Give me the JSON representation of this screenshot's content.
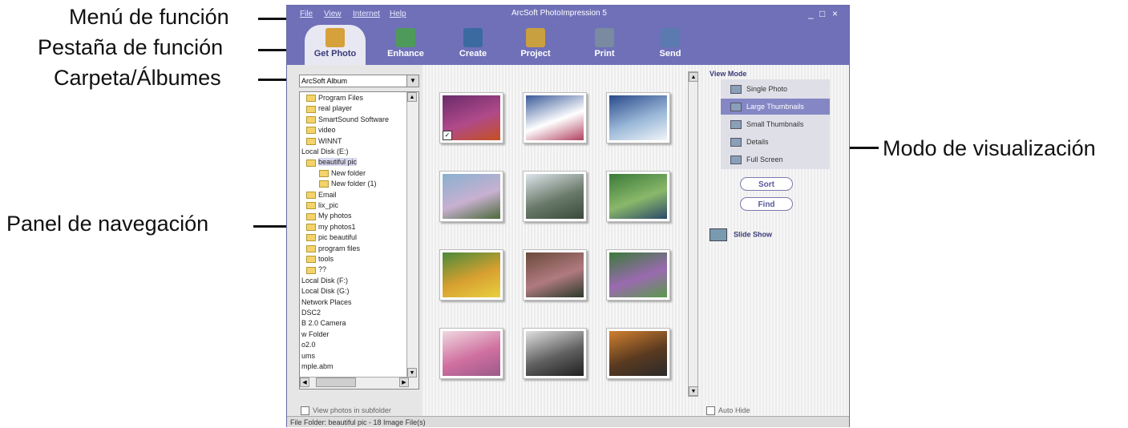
{
  "annotations": {
    "menu": "Menú de función",
    "tabs": "Pestaña de función",
    "albums": "Carpeta/Álbumes",
    "nav_panel": "Panel de navegación",
    "view_mode": "Modo de visualización"
  },
  "window": {
    "title": "ArcSoft PhotoImpression 5",
    "menu": [
      "File",
      "View",
      "Internet",
      "Help"
    ],
    "controls": [
      "_",
      "□",
      "×"
    ]
  },
  "tabs": [
    {
      "label": "Get Photo",
      "icon": "get-photo-icon",
      "color": "#d6a03a"
    },
    {
      "label": "Enhance",
      "icon": "enhance-icon",
      "color": "#4e9a5a"
    },
    {
      "label": "Create",
      "icon": "create-icon",
      "color": "#3a6aa0"
    },
    {
      "label": "Project",
      "icon": "project-icon",
      "color": "#c9a040"
    },
    {
      "label": "Print",
      "icon": "print-icon",
      "color": "#7a8aa0"
    },
    {
      "label": "Send",
      "icon": "send-icon",
      "color": "#5a7ab0"
    }
  ],
  "nav": {
    "album_select": "ArcSoft Album",
    "tree": [
      "Program Files",
      "real player",
      "SmartSound Software",
      "video",
      "WINNT",
      "Local Disk (E:)",
      "beautiful pic",
      "New folder",
      "New folder (1)",
      "Email",
      "lix_pic",
      "My photos",
      "my photos1",
      "pic beautiful",
      "program files",
      "tools",
      "??",
      "Local Disk (F:)",
      "Local Disk (G:)",
      "Network Places",
      "DSC2",
      "B 2.0 Camera",
      "w Folder",
      "o2.0",
      "ums",
      "mple.abm"
    ],
    "subfolder_label": "View photos in subfolder"
  },
  "thumbnails": [
    {
      "colors": [
        "#6a2a6a",
        "#b04a8a",
        "#c45020"
      ]
    },
    {
      "colors": [
        "#3a5a9a",
        "#ffffff",
        "#b04060"
      ]
    },
    {
      "colors": [
        "#2a4a8a",
        "#9ab8d8",
        "#f0f4f8"
      ]
    },
    {
      "colors": [
        "#8ab0d0",
        "#c8b0d0",
        "#4a6a3a"
      ]
    },
    {
      "colors": [
        "#dde4ea",
        "#6a7a6a",
        "#3a4a3a"
      ]
    },
    {
      "colors": [
        "#3a7a3a",
        "#8ab86a",
        "#2a4a6a"
      ]
    },
    {
      "colors": [
        "#4a8a3a",
        "#d8a030",
        "#e8d040"
      ]
    },
    {
      "colors": [
        "#6a4a3a",
        "#b07a80",
        "#2a3a2a"
      ]
    },
    {
      "colors": [
        "#3a7a3a",
        "#9a6ab0",
        "#5a9a4a"
      ]
    },
    {
      "colors": [
        "#f0d8e0",
        "#d070a0",
        "#9a5a8a"
      ]
    },
    {
      "colors": [
        "#e0e0e0",
        "#606060",
        "#202020"
      ]
    },
    {
      "colors": [
        "#d08030",
        "#5a3a20",
        "#2a2a2a"
      ]
    }
  ],
  "view_mode": {
    "title": "View Mode",
    "items": [
      "Single Photo",
      "Large Thumbnails",
      "Small Thumbnails",
      "Details",
      "Full Screen"
    ],
    "selected": "Large Thumbnails",
    "sort": "Sort",
    "find": "Find",
    "slideshow": "Slide Show",
    "autohide": "Auto Hide"
  },
  "status": "File Folder: beautiful pic - 18 Image File(s)"
}
